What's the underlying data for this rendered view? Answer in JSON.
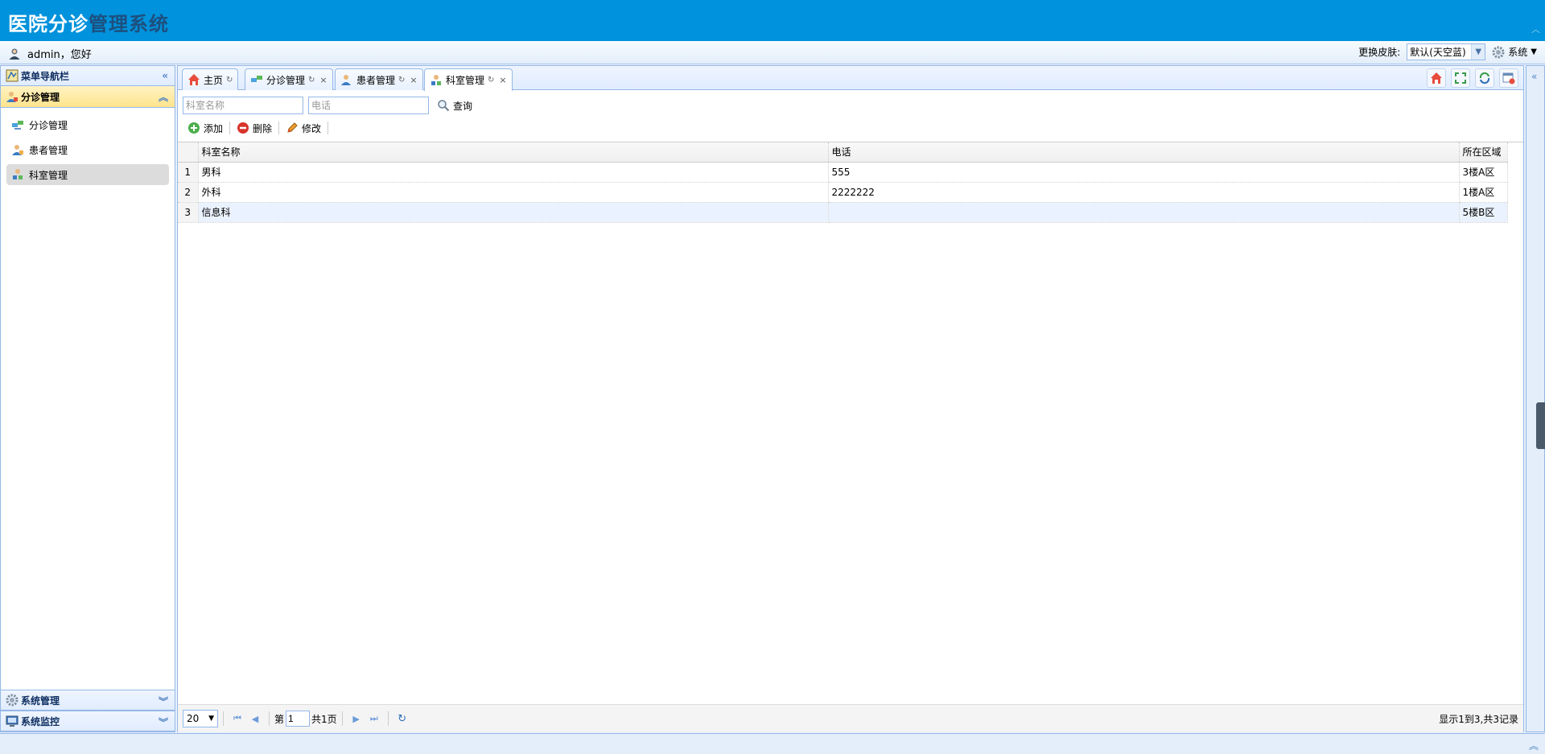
{
  "app": {
    "title_part1": "医院分诊",
    "title_part2": "管理系统"
  },
  "userbar": {
    "greeting": "admin，您好",
    "skin_label": "更换皮肤:",
    "skin_value": "默认(天空蓝)",
    "system_menu": "系统"
  },
  "sidebar": {
    "title": "菜单导航栏",
    "group_active": "分诊管理",
    "items": [
      {
        "label": "分诊管理",
        "icon": "transfer-icon"
      },
      {
        "label": "患者管理",
        "icon": "patient-icon"
      },
      {
        "label": "科室管理",
        "icon": "department-icon"
      }
    ],
    "groups_bottom": [
      {
        "label": "系统管理",
        "icon": "gear-icon"
      },
      {
        "label": "系统监控",
        "icon": "monitor-icon"
      }
    ]
  },
  "tabs": [
    {
      "label": "主页"
    },
    {
      "label": "分诊管理"
    },
    {
      "label": "患者管理"
    },
    {
      "label": "科室管理"
    }
  ],
  "search": {
    "dept_placeholder": "科室名称",
    "phone_placeholder": "电话",
    "button_label": "查询"
  },
  "toolbar": {
    "add": "添加",
    "delete": "删除",
    "edit": "修改"
  },
  "grid": {
    "columns": [
      "科室名称",
      "电话",
      "所在区域"
    ],
    "rows": [
      {
        "num": "1",
        "name": "男科",
        "phone": "555",
        "area": "3楼A区"
      },
      {
        "num": "2",
        "name": "外科",
        "phone": "2222222",
        "area": "1楼A区"
      },
      {
        "num": "3",
        "name": "信息科",
        "phone": "",
        "area": "5楼B区"
      }
    ]
  },
  "pagination": {
    "page_size": "20",
    "page_prefix": "第",
    "current_page": "1",
    "total_pages": "共1页",
    "info": "显示1到3,共3记录"
  },
  "colors": {
    "header": "#0092dc",
    "border": "#95b8e7",
    "selected_group": "#ffe48d"
  }
}
